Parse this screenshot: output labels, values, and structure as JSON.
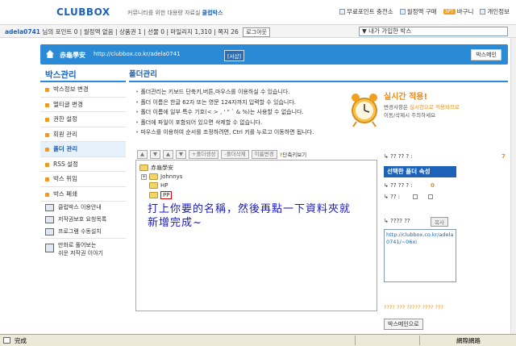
{
  "topbar": {
    "logo": "CLUBBOX",
    "slogan_prefix": "커뮤니티를 위한 대용량 자료실",
    "slogan_highlight": "클럽박스",
    "links": [
      "무료포인트 충전소",
      "월정액 구매",
      "바구니",
      "개인정보"
    ],
    "points_badge": "3PT"
  },
  "userbar": {
    "username": "adela0741",
    "suffix": "님의",
    "stats": "포인트 0 | 월정액 없음 | 상품권 1 | 선물 0 | 마일리지 1,310 | 쪽지 26",
    "logout_label": "로그아웃",
    "box_select": "▼ 내가 가입한 박스"
  },
  "urlbar": {
    "club_name": "赤龜學安",
    "url": "http://clubbox.co.kr/adela0741",
    "tag": "[서샵]",
    "box_main_label": "박스메인"
  },
  "sidebar": {
    "title": "박스관리",
    "items": [
      {
        "label": "박스정보 변경",
        "active": false
      },
      {
        "label": "멀티글 변경",
        "active": false
      },
      {
        "label": "권한 설정",
        "active": false
      },
      {
        "label": "회원 관리",
        "active": false
      },
      {
        "label": "폴더 관리",
        "active": true
      },
      {
        "label": "RSS 설정",
        "active": false
      },
      {
        "label": "박스 위임",
        "active": false
      },
      {
        "label": "박스 폐쇄",
        "active": false
      }
    ],
    "extras": [
      "클럽박스 이용안내",
      "저작권보호 요청목록",
      "프로그램 수동설치"
    ],
    "extra_multi": [
      "만화로 풀어보는",
      "쉬운 저작권 이야기"
    ]
  },
  "main": {
    "title": "폴더관리",
    "notices": [
      "폴더관리는 키보드 단축키,버튼,마우스를 이용하실 수 있습니다.",
      "폴더 이름은 한글 62자 또는 영문 124자까지 입력할 수 있습니다.",
      "폴더 이름에 일부 특수 기호(< > , ' \" ` & %)는 사용할 수 없습니다.",
      "폴더에 파일이 포함되어 있으면 삭제할 수 없습니다.",
      "마우스를 이용하여 순서를 조정하려면, Ctrl 키를 누르고 이동하면 됩니다."
    ]
  },
  "realtime": {
    "title": "실시간 적용!",
    "desc1_prefix": "변경사항은",
    "desc1_highlight": "실시간으로 적용되므로",
    "desc2": "이동/삭제시 주의하세요"
  },
  "toolbar": {
    "arrows": [
      "▲",
      "▼",
      "▲",
      "▼"
    ],
    "buttons": [
      "+폴더생성",
      "-폴더삭제",
      "이름변경"
    ],
    "help": "단축키보기"
  },
  "tree": {
    "root": "赤龜學安",
    "nodes": [
      "Johnnys",
      "HP",
      "PP"
    ],
    "handwriting_line1": "打上你要的名稱，然後再點一下資料夾就",
    "handwriting_line2": "新增完成~"
  },
  "rpanel": {
    "row1_label": "?? ?? ? :",
    "row1_value": "7",
    "header": "선택한 폴더 속성",
    "row2_label": "?? ?? ? :",
    "row2_value": "0",
    "row3_label": "?? :",
    "row4_label": "???? ??",
    "copy_label": "복사",
    "url_text": "http://clubbox.co.kr/adela0741/~06xi",
    "orange_text": "???? ??? ????? ???? ???",
    "mainbtn_label": "박스메인으로"
  },
  "status": {
    "text": "完成",
    "zone": "網際網路"
  }
}
